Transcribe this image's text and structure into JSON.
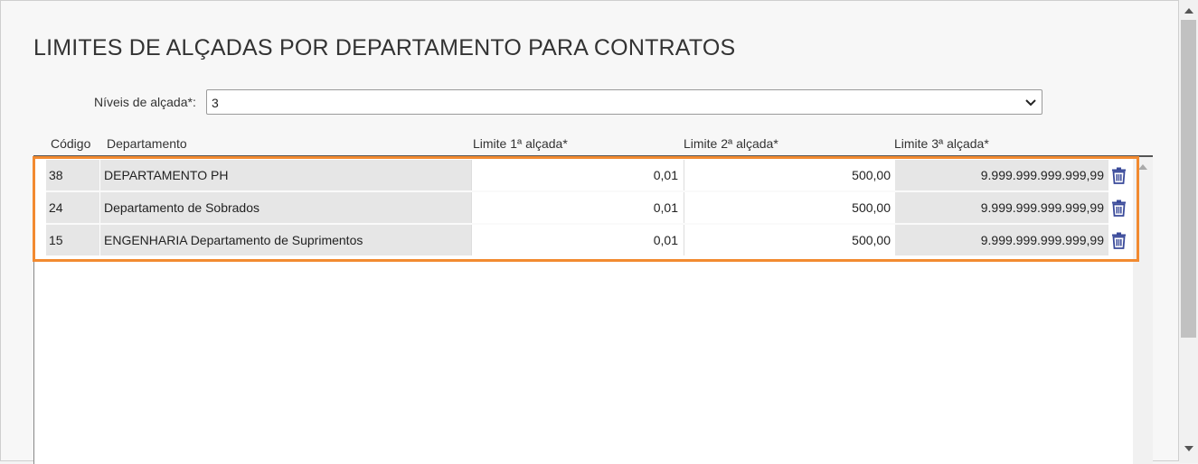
{
  "dialog": {
    "title": "LIMITES DE ALÇADAS POR DEPARTAMENTO PARA CONTRATOS"
  },
  "niveis": {
    "label": "Níveis de alçada*:",
    "value": "3"
  },
  "table": {
    "headers": {
      "codigo": "Código",
      "departamento": "Departamento",
      "limite1": "Limite 1ª alçada*",
      "limite2": "Limite 2ª alçada*",
      "limite3": "Limite 3ª alçada*"
    },
    "rows": [
      {
        "codigo": "38",
        "departamento": "DEPARTAMENTO PH",
        "limite1": "0,01",
        "limite2": "500,00",
        "limite3": "9.999.999.999.999,99"
      },
      {
        "codigo": "24",
        "departamento": "Departamento de Sobrados",
        "limite1": "0,01",
        "limite2": "500,00",
        "limite3": "9.999.999.999.999,99"
      },
      {
        "codigo": "15",
        "departamento": "ENGENHARIA Departamento de Suprimentos",
        "limite1": "0,01",
        "limite2": "500,00",
        "limite3": "9.999.999.999.999,99"
      }
    ],
    "delete_icon": "trash-icon"
  },
  "colors": {
    "highlight": "#f28a30",
    "icon": "#3a4a9a"
  }
}
